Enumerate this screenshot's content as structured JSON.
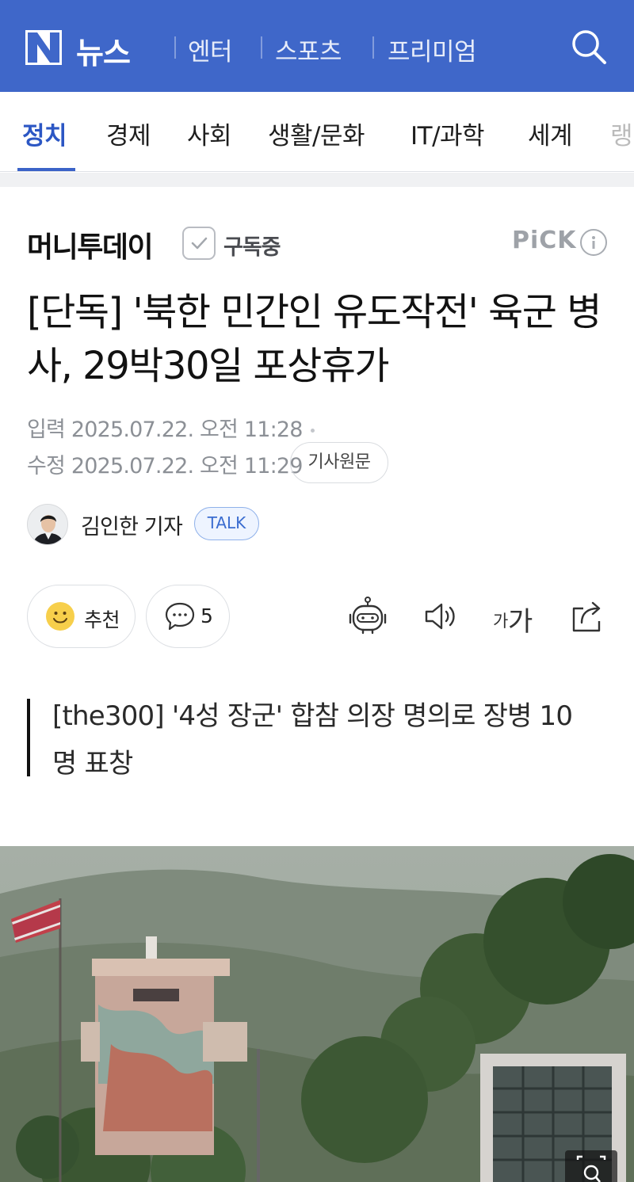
{
  "header": {
    "logo_letter": "N",
    "brand": "뉴스",
    "services": [
      "엔터",
      "스포츠",
      "프리미엄"
    ],
    "search_icon": "search-icon",
    "bg_color": "#3f67c9"
  },
  "category_nav": {
    "items": [
      {
        "label": "정치",
        "active": true
      },
      {
        "label": "경제",
        "active": false
      },
      {
        "label": "사회",
        "active": false
      },
      {
        "label": "생활/문화",
        "active": false
      },
      {
        "label": "IT/과학",
        "active": false
      },
      {
        "label": "세계",
        "active": false
      },
      {
        "label": "랭",
        "active": false
      }
    ],
    "active_color": "#2c57c4"
  },
  "article": {
    "press": "머니투데이",
    "subscribe_label": "구독중",
    "pick_label": "PiCK",
    "headline": "[단독] '북한 민간인 유도작전' 육군 병사, 29박30일 포상휴가",
    "input_time": "입력 2025.07.22. 오전 11:28",
    "modified_time": "수정 2025.07.22. 오전 11:29",
    "original_button": "기사원문",
    "reporter": "김인한 기자",
    "talk_label": "TALK",
    "recommend_label": "추천",
    "comment_count": "5",
    "font_size_small": "가",
    "font_size_big": "가",
    "summary": "[the300] '4성 장군' 합참 의장 명의로 장병 10명 표창"
  },
  "icons": {
    "recommend": "smiley-icon",
    "comment": "comment-bubble-icon",
    "summary_bot": "robot-icon",
    "tts": "speaker-icon",
    "share": "share-icon",
    "zoom": "magnifier-icon"
  }
}
